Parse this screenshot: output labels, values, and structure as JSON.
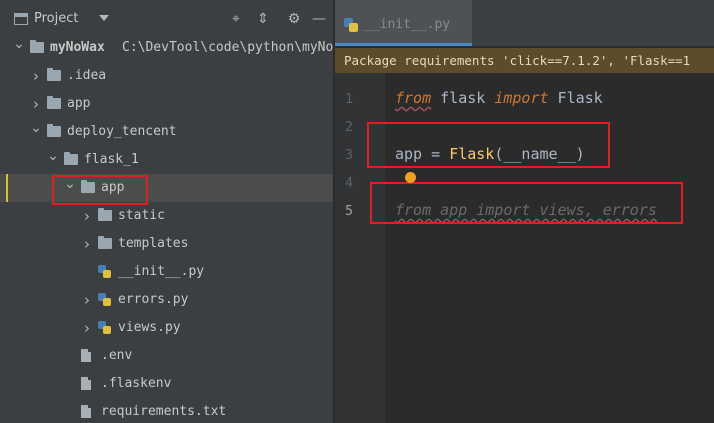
{
  "project_panel": {
    "title": "Project",
    "header_icons": [
      "crosshair-icon",
      "collapse-all-icon",
      "gear-icon",
      "minimize-icon"
    ],
    "tree": [
      {
        "label": "myNoWax",
        "path": "C:\\DevTool\\code\\python\\myNoWa",
        "type": "folder",
        "expanded": true
      },
      {
        "label": ".idea",
        "type": "folder",
        "expanded": false
      },
      {
        "label": "app",
        "type": "folder",
        "expanded": false
      },
      {
        "label": "deploy_tencent",
        "type": "folder",
        "expanded": true
      },
      {
        "label": "flask_1",
        "type": "folder",
        "expanded": true
      },
      {
        "label": "app",
        "type": "folder",
        "expanded": true,
        "selected": true
      },
      {
        "label": "static",
        "type": "folder",
        "expanded": false
      },
      {
        "label": "templates",
        "type": "folder",
        "expanded": false
      },
      {
        "label": "__init__.py",
        "type": "python-file"
      },
      {
        "label": "errors.py",
        "type": "python-file",
        "expanded": false
      },
      {
        "label": "views.py",
        "type": "python-file",
        "expanded": false
      },
      {
        "label": ".env",
        "type": "file"
      },
      {
        "label": ".flaskenv",
        "type": "file"
      },
      {
        "label": "requirements.txt",
        "type": "file"
      }
    ]
  },
  "editor": {
    "tab": {
      "label": "__init__.py",
      "icon": "python-file-icon"
    },
    "banner": "Package requirements 'click==7.1.2', 'Flask==1",
    "current_line": 5,
    "lines": [
      {
        "number": "1",
        "tokens": [
          {
            "t": "from",
            "k": "kw"
          },
          {
            "t": " flask ",
            "k": "fn"
          },
          {
            "t": "import",
            "k": "kw"
          },
          {
            "t": " Flask",
            "k": "fn"
          }
        ]
      },
      {
        "number": "2",
        "tokens": []
      },
      {
        "number": "3",
        "tokens": [
          {
            "t": "app",
            "k": "fn"
          },
          {
            "t": " = ",
            "k": "fn"
          },
          {
            "t": "Flask",
            "k": "cls"
          },
          {
            "t": "(__name__)",
            "k": "fn"
          }
        ]
      },
      {
        "number": "4",
        "tokens": []
      },
      {
        "number": "5",
        "tokens": [
          {
            "t": "from app import views, errors",
            "k": "dim"
          }
        ]
      }
    ]
  },
  "colors": {
    "accent": "#4a88c7",
    "highlight_box": "#e02020",
    "banner_bg": "#5c4c2c"
  }
}
